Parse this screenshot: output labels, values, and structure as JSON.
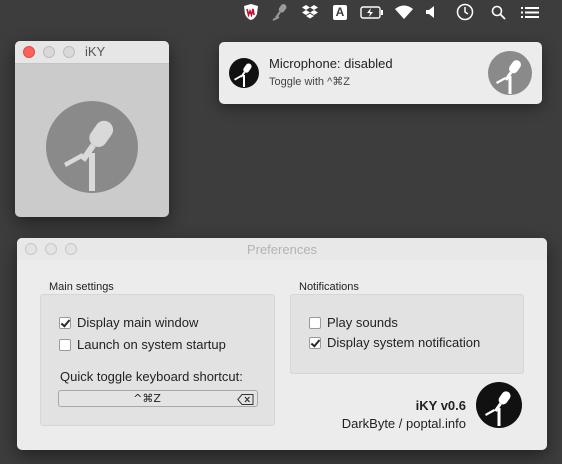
{
  "menubar": {
    "icons": [
      "shield-icon",
      "microphone-icon",
      "dropbox-icon",
      "text-input-icon",
      "battery-icon",
      "wifi-icon",
      "volume-icon",
      "clock-icon",
      "search-icon",
      "menu-list-icon"
    ],
    "input_source_letter": "A"
  },
  "main_window": {
    "title": "iKY"
  },
  "notification": {
    "title": "Microphone: disabled",
    "subtitle": "Toggle with ^⌘Z"
  },
  "preferences": {
    "title": "Preferences",
    "main_settings": {
      "label": "Main settings",
      "display_main_window": {
        "label": "Display main window",
        "checked": true
      },
      "launch_on_startup": {
        "label": "Launch on system startup",
        "checked": false
      },
      "shortcut_label": "Quick toggle keyboard shortcut:",
      "shortcut_value": "^⌘Z"
    },
    "notifications": {
      "label": "Notifications",
      "play_sounds": {
        "label": "Play sounds",
        "checked": false
      },
      "display_notification": {
        "label": "Display system notification",
        "checked": true
      }
    },
    "about": {
      "app_version": "iKY v0.6",
      "author": "DarkByte / poptal.info"
    }
  },
  "colors": {
    "desktop": "#3d3d3d",
    "close_button": "#fc605b",
    "mic_gray": "#8a8a8a",
    "mic_dark": "#111111"
  }
}
